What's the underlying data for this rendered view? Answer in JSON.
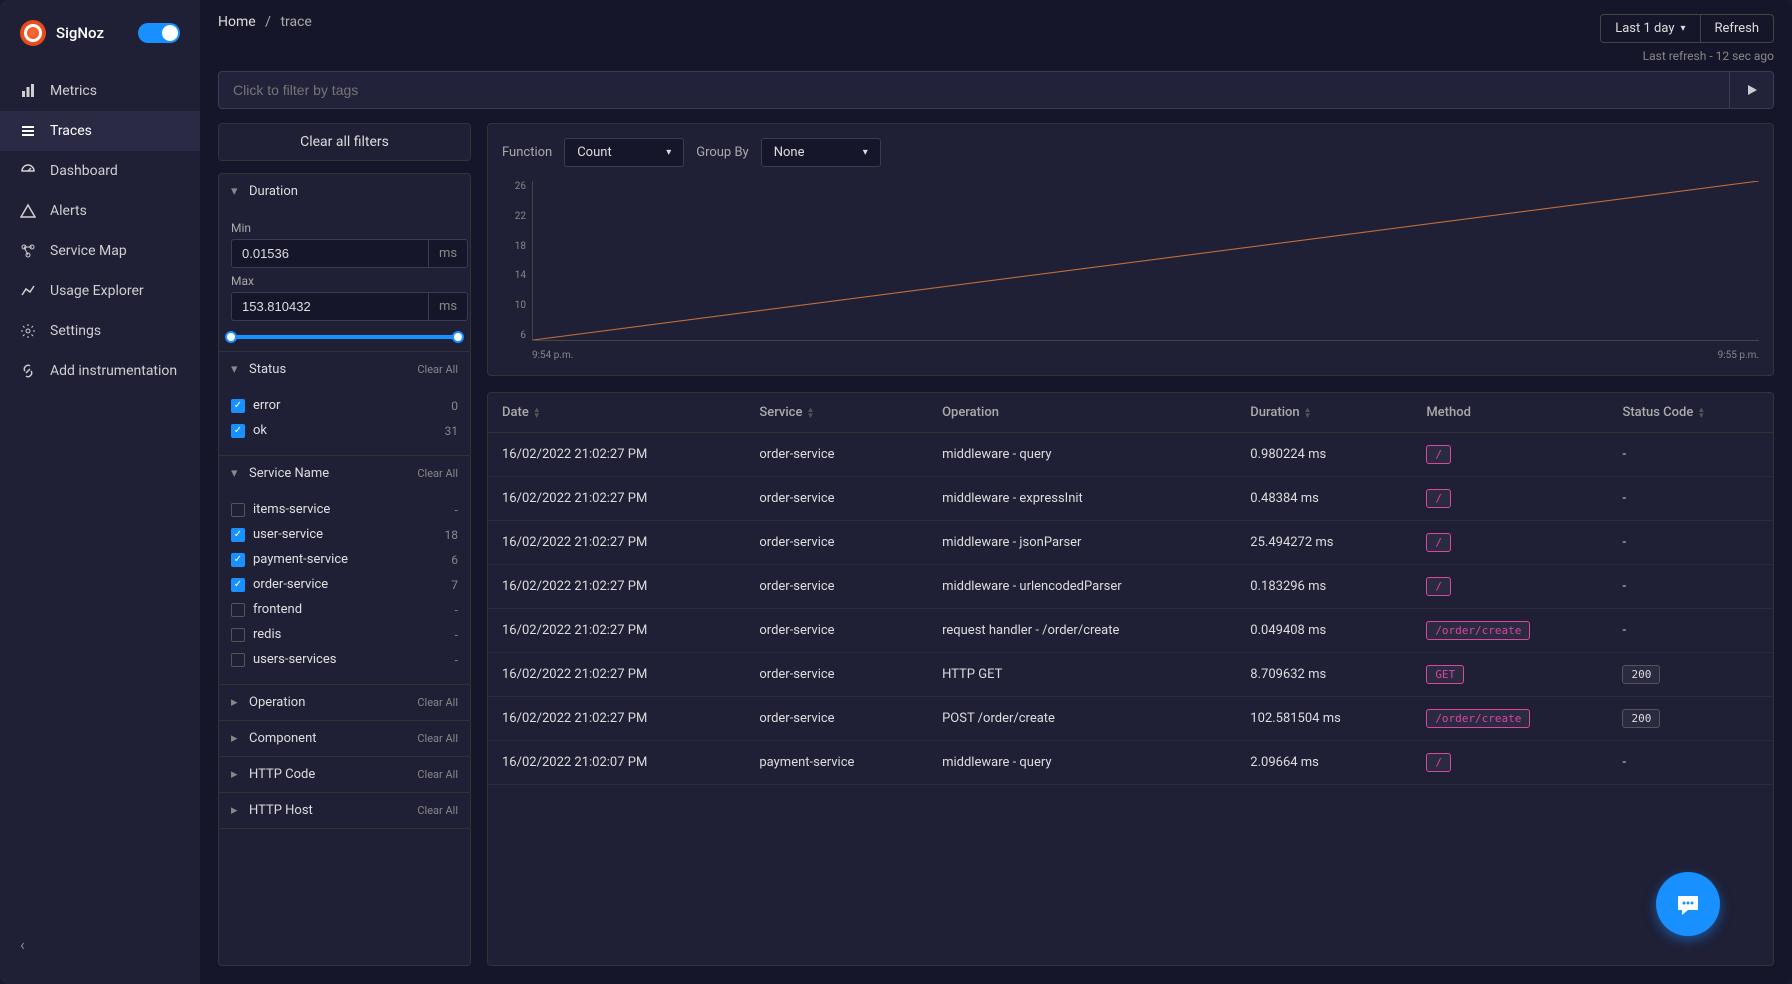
{
  "app": {
    "name": "SigNoz"
  },
  "nav": {
    "items": [
      {
        "label": "Metrics",
        "active": false
      },
      {
        "label": "Traces",
        "active": true
      },
      {
        "label": "Dashboard",
        "active": false
      },
      {
        "label": "Alerts",
        "active": false
      },
      {
        "label": "Service Map",
        "active": false
      },
      {
        "label": "Usage Explorer",
        "active": false
      },
      {
        "label": "Settings",
        "active": false
      },
      {
        "label": "Add instrumentation",
        "active": false
      }
    ]
  },
  "breadcrumb": {
    "home": "Home",
    "current": "trace"
  },
  "time_selector": {
    "label": "Last 1 day"
  },
  "refresh_button": "Refresh",
  "last_refresh": "Last refresh - 12 sec ago",
  "search": {
    "placeholder": "Click to filter by tags"
  },
  "filters": {
    "clear_all_button": "Clear all filters",
    "duration": {
      "title": "Duration",
      "min_label": "Min",
      "min_value": "0.01536",
      "max_label": "Max",
      "max_value": "153.810432",
      "unit": "ms"
    },
    "status": {
      "title": "Status",
      "clear": "Clear All",
      "items": [
        {
          "label": "error",
          "count": "0",
          "checked": true
        },
        {
          "label": "ok",
          "count": "31",
          "checked": true
        }
      ]
    },
    "service_name": {
      "title": "Service Name",
      "clear": "Clear All",
      "items": [
        {
          "label": "items-service",
          "count": "-",
          "checked": false
        },
        {
          "label": "user-service",
          "count": "18",
          "checked": true
        },
        {
          "label": "payment-service",
          "count": "6",
          "checked": true
        },
        {
          "label": "order-service",
          "count": "7",
          "checked": true
        },
        {
          "label": "frontend",
          "count": "-",
          "checked": false
        },
        {
          "label": "redis",
          "count": "-",
          "checked": false
        },
        {
          "label": "users-services",
          "count": "-",
          "checked": false
        }
      ]
    },
    "operation": {
      "title": "Operation",
      "clear": "Clear All"
    },
    "component": {
      "title": "Component",
      "clear": "Clear All"
    },
    "http_code": {
      "title": "HTTP Code",
      "clear": "Clear All"
    },
    "http_host": {
      "title": "HTTP Host",
      "clear": "Clear All"
    }
  },
  "chart": {
    "function_label": "Function",
    "function_value": "Count",
    "groupby_label": "Group By",
    "groupby_value": "None"
  },
  "chart_data": {
    "type": "line",
    "series": [
      {
        "name": "count",
        "x": [
          "9:54 p.m.",
          "9:55 p.m."
        ],
        "y": [
          6,
          26
        ]
      }
    ],
    "ylim": [
      6,
      26
    ],
    "yticks": [
      26,
      22,
      18,
      14,
      10,
      6
    ],
    "xticks": [
      "9:54 p.m.",
      "9:55 p.m."
    ],
    "xlabel": "",
    "ylabel": ""
  },
  "table": {
    "columns": {
      "date": "Date",
      "service": "Service",
      "operation": "Operation",
      "duration": "Duration",
      "method": "Method",
      "status_code": "Status Code"
    },
    "rows": [
      {
        "date": "16/02/2022 21:02:27 PM",
        "service": "order-service",
        "operation": "middleware - query",
        "duration": "0.980224 ms",
        "method": "/",
        "status": "-"
      },
      {
        "date": "16/02/2022 21:02:27 PM",
        "service": "order-service",
        "operation": "middleware - expressInit",
        "duration": "0.48384 ms",
        "method": "/",
        "status": "-"
      },
      {
        "date": "16/02/2022 21:02:27 PM",
        "service": "order-service",
        "operation": "middleware - jsonParser",
        "duration": "25.494272 ms",
        "method": "/",
        "status": "-"
      },
      {
        "date": "16/02/2022 21:02:27 PM",
        "service": "order-service",
        "operation": "middleware - urlencodedParser",
        "duration": "0.183296 ms",
        "method": "/",
        "status": "-"
      },
      {
        "date": "16/02/2022 21:02:27 PM",
        "service": "order-service",
        "operation": "request handler - /order/create",
        "duration": "0.049408 ms",
        "method": "/order/create",
        "status": "-"
      },
      {
        "date": "16/02/2022 21:02:27 PM",
        "service": "order-service",
        "operation": "HTTP GET",
        "duration": "8.709632 ms",
        "method": "GET",
        "status": "200"
      },
      {
        "date": "16/02/2022 21:02:27 PM",
        "service": "order-service",
        "operation": "POST /order/create",
        "duration": "102.581504 ms",
        "method": "/order/create",
        "status": "200"
      },
      {
        "date": "16/02/2022 21:02:07 PM",
        "service": "payment-service",
        "operation": "middleware - query",
        "duration": "2.09664 ms",
        "method": "/",
        "status": "-"
      }
    ]
  }
}
